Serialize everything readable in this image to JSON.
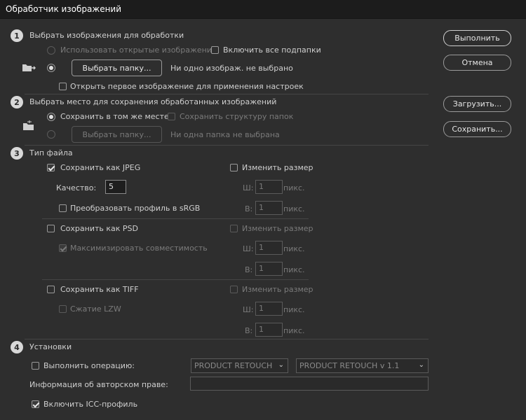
{
  "window": {
    "title": "Обработчик изображений"
  },
  "actions": {
    "run": "Выполнить",
    "cancel": "Отмена",
    "load": "Загрузить...",
    "save": "Сохранить..."
  },
  "section1": {
    "number": "1",
    "title": "Выбрать изображения для обработки",
    "use_open_images": "Использовать открытые изображения",
    "include_subfolders": "Включить все подпапки",
    "select_folder": "Выбрать папку...",
    "status": "Ни одно изображ. не выбрано",
    "open_first": "Открыть первое изображение для применения настроек"
  },
  "section2": {
    "number": "2",
    "title": "Выбрать место для сохранения обработанных изображений",
    "save_same_place": "Сохранить в том же месте",
    "keep_structure": "Сохранить структуру папок",
    "select_folder": "Выбрать папку...",
    "status": "Ни одна папка не выбрана"
  },
  "section3": {
    "number": "3",
    "title": "Тип файла",
    "jpeg": {
      "label": "Сохранить как JPEG",
      "checked": true,
      "resize": "Изменить размер",
      "quality_label": "Качество:",
      "quality_value": "5",
      "convert_srgb": "Преобразовать профиль в sRGB",
      "w_label": "Ш:",
      "w_value": "1",
      "h_label": "В:",
      "h_value": "1",
      "unit": "пикс."
    },
    "psd": {
      "label": "Сохранить как PSD",
      "resize": "Изменить размер",
      "maximize": "Максимизировать совместимость",
      "w_label": "Ш:",
      "w_value": "1",
      "h_label": "В:",
      "h_value": "1",
      "unit": "пикс."
    },
    "tiff": {
      "label": "Сохранить как TIFF",
      "resize": "Изменить размер",
      "lzw": "Сжатие LZW",
      "w_label": "Ш:",
      "w_value": "1",
      "h_label": "В:",
      "h_value": "1",
      "unit": "пикс."
    }
  },
  "section4": {
    "number": "4",
    "title": "Установки",
    "run_action": "Выполнить операцию:",
    "action_set": "PRODUCT RETOUCH",
    "action": "PRODUCT RETOUCH v 1.1",
    "copyright_label": "Информация об авторском праве:",
    "copyright_value": "",
    "include_icc": "Включить ICC-профиль"
  },
  "icons": {
    "source_folder": "folder-arrow-icon",
    "dest_folder": "folder-dest-icon",
    "dropdown": "chevron-down-icon"
  }
}
